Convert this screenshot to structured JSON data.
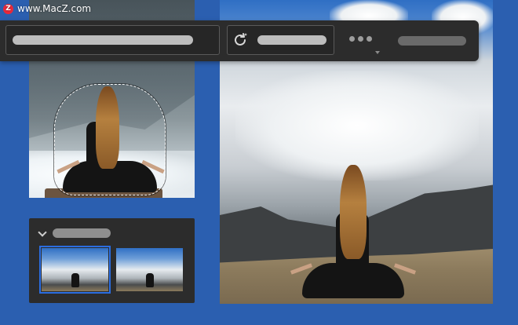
{
  "watermark": {
    "text": "www.MacZ.com",
    "logo_letter": "Z"
  },
  "colors": {
    "background": "#2b5fb0",
    "panel": "#2c2c2c",
    "selection_accent": "#2b6de0"
  },
  "toolbar": {
    "fields": [
      {
        "kind": "text-field-placeholder-bar"
      },
      {
        "kind": "ai-generate-button",
        "icon": "refresh-sparkle-icon"
      },
      {
        "kind": "more-menu",
        "icon": "more-dots-icon"
      },
      {
        "kind": "label-placeholder-bar"
      }
    ]
  },
  "layers_panel": {
    "collapsed_icon": "chevron-down-icon",
    "thumbnails": [
      {
        "name": "thumb-1",
        "selected": true
      },
      {
        "name": "thumb-2",
        "selected": false
      }
    ]
  }
}
